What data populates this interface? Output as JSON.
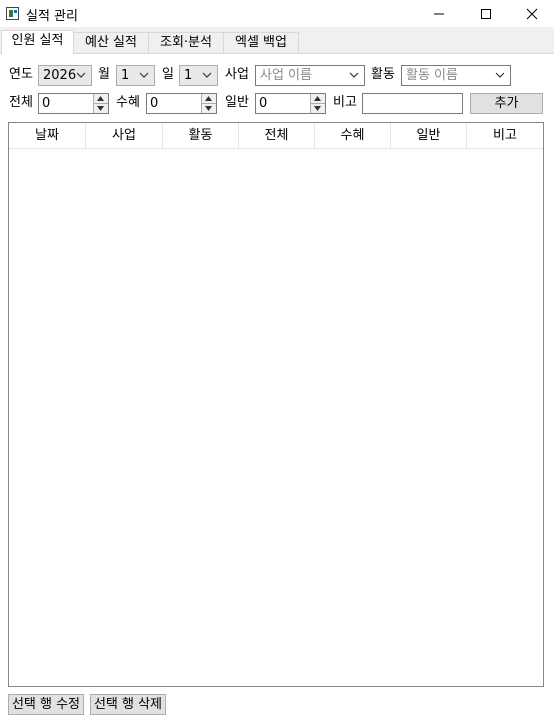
{
  "window": {
    "title": "실적 관리"
  },
  "tabs": [
    {
      "label": "인원 실적",
      "active": true
    },
    {
      "label": "예산 실적",
      "active": false
    },
    {
      "label": "조회·분석",
      "active": false
    },
    {
      "label": "엑셀 백업",
      "active": false
    }
  ],
  "form": {
    "year_label": "연도",
    "year_value": "2026",
    "month_label": "월",
    "month_value": "1",
    "day_label": "일",
    "day_value": "1",
    "project_label": "사업",
    "project_placeholder": "사업 이름",
    "activity_label": "활동",
    "activity_placeholder": "활동 이름",
    "total_label": "전체",
    "total_value": "0",
    "beneficiary_label": "수혜",
    "beneficiary_value": "0",
    "general_label": "일반",
    "general_value": "0",
    "note_label": "비고",
    "note_value": "",
    "add_button": "추가"
  },
  "table": {
    "columns": [
      "날짜",
      "사업",
      "활동",
      "전체",
      "수혜",
      "일반",
      "비고"
    ],
    "rows": []
  },
  "actions": {
    "edit_selected": "선택 행 수정",
    "delete_selected": "선택 행 삭제"
  }
}
